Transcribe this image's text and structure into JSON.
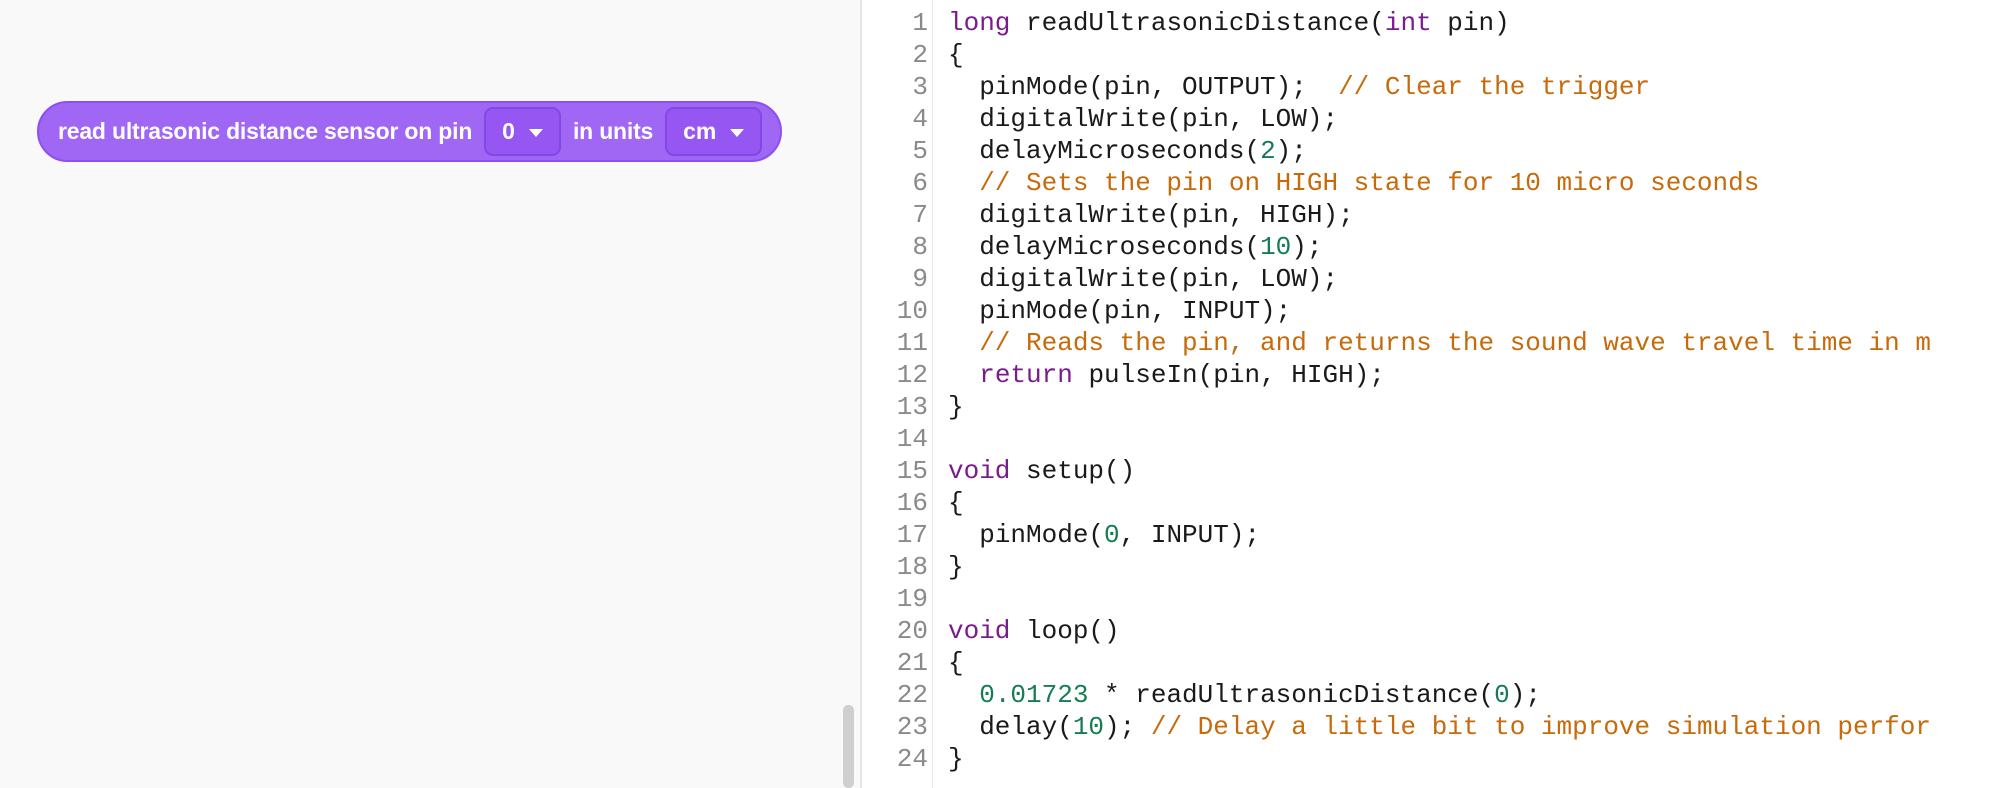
{
  "block": {
    "label_prefix": "read ultrasonic distance sensor on pin",
    "pin_value": "0",
    "label_units": "in units",
    "units_value": "cm",
    "color": "#a066f4"
  },
  "code": {
    "lines": [
      {
        "n": "1",
        "tokens": [
          [
            "kw",
            "long"
          ],
          [
            "p",
            " readUltrasonicDistance("
          ],
          [
            "kw",
            "int"
          ],
          [
            "p",
            " pin)"
          ]
        ]
      },
      {
        "n": "2",
        "tokens": [
          [
            "p",
            "{"
          ]
        ]
      },
      {
        "n": "3",
        "tokens": [
          [
            "p",
            "  pinMode(pin, OUTPUT);  "
          ],
          [
            "cm",
            "// Clear the trigger"
          ]
        ]
      },
      {
        "n": "4",
        "tokens": [
          [
            "p",
            "  digitalWrite(pin, LOW);"
          ]
        ]
      },
      {
        "n": "5",
        "tokens": [
          [
            "p",
            "  delayMicroseconds("
          ],
          [
            "num",
            "2"
          ],
          [
            "p",
            ");"
          ]
        ]
      },
      {
        "n": "6",
        "tokens": [
          [
            "cm",
            "  // Sets the pin on HIGH state for 10 micro seconds"
          ]
        ]
      },
      {
        "n": "7",
        "tokens": [
          [
            "p",
            "  digitalWrite(pin, HIGH);"
          ]
        ]
      },
      {
        "n": "8",
        "tokens": [
          [
            "p",
            "  delayMicroseconds("
          ],
          [
            "num",
            "10"
          ],
          [
            "p",
            ");"
          ]
        ]
      },
      {
        "n": "9",
        "tokens": [
          [
            "p",
            "  digitalWrite(pin, LOW);"
          ]
        ]
      },
      {
        "n": "10",
        "tokens": [
          [
            "p",
            "  pinMode(pin, INPUT);"
          ]
        ]
      },
      {
        "n": "11",
        "tokens": [
          [
            "cm",
            "  // Reads the pin, and returns the sound wave travel time in m"
          ]
        ]
      },
      {
        "n": "12",
        "tokens": [
          [
            "p",
            "  "
          ],
          [
            "kw",
            "return"
          ],
          [
            "p",
            " pulseIn(pin, HIGH);"
          ]
        ]
      },
      {
        "n": "13",
        "tokens": [
          [
            "p",
            "}"
          ]
        ]
      },
      {
        "n": "14",
        "tokens": []
      },
      {
        "n": "15",
        "tokens": [
          [
            "kw",
            "void"
          ],
          [
            "p",
            " setup()"
          ]
        ]
      },
      {
        "n": "16",
        "tokens": [
          [
            "p",
            "{"
          ]
        ]
      },
      {
        "n": "17",
        "tokens": [
          [
            "p",
            "  pinMode("
          ],
          [
            "num",
            "0"
          ],
          [
            "p",
            ", INPUT);"
          ]
        ]
      },
      {
        "n": "18",
        "tokens": [
          [
            "p",
            "}"
          ]
        ]
      },
      {
        "n": "19",
        "tokens": []
      },
      {
        "n": "20",
        "tokens": [
          [
            "kw",
            "void"
          ],
          [
            "p",
            " loop()"
          ]
        ]
      },
      {
        "n": "21",
        "tokens": [
          [
            "p",
            "{"
          ]
        ]
      },
      {
        "n": "22",
        "tokens": [
          [
            "p",
            "  "
          ],
          [
            "num",
            "0.01723"
          ],
          [
            "p",
            " * readUltrasonicDistance("
          ],
          [
            "num",
            "0"
          ],
          [
            "p",
            ");"
          ]
        ]
      },
      {
        "n": "23",
        "tokens": [
          [
            "p",
            "  delay("
          ],
          [
            "num",
            "10"
          ],
          [
            "p",
            "); "
          ],
          [
            "cm",
            "// Delay a little bit to improve simulation perfor"
          ]
        ]
      },
      {
        "n": "24",
        "tokens": [
          [
            "p",
            "}"
          ]
        ]
      }
    ],
    "colors": {
      "keyword": "#7a1c8e",
      "comment": "#c66a0a",
      "number": "#177c55",
      "line_number": "#8a8a8a"
    }
  }
}
